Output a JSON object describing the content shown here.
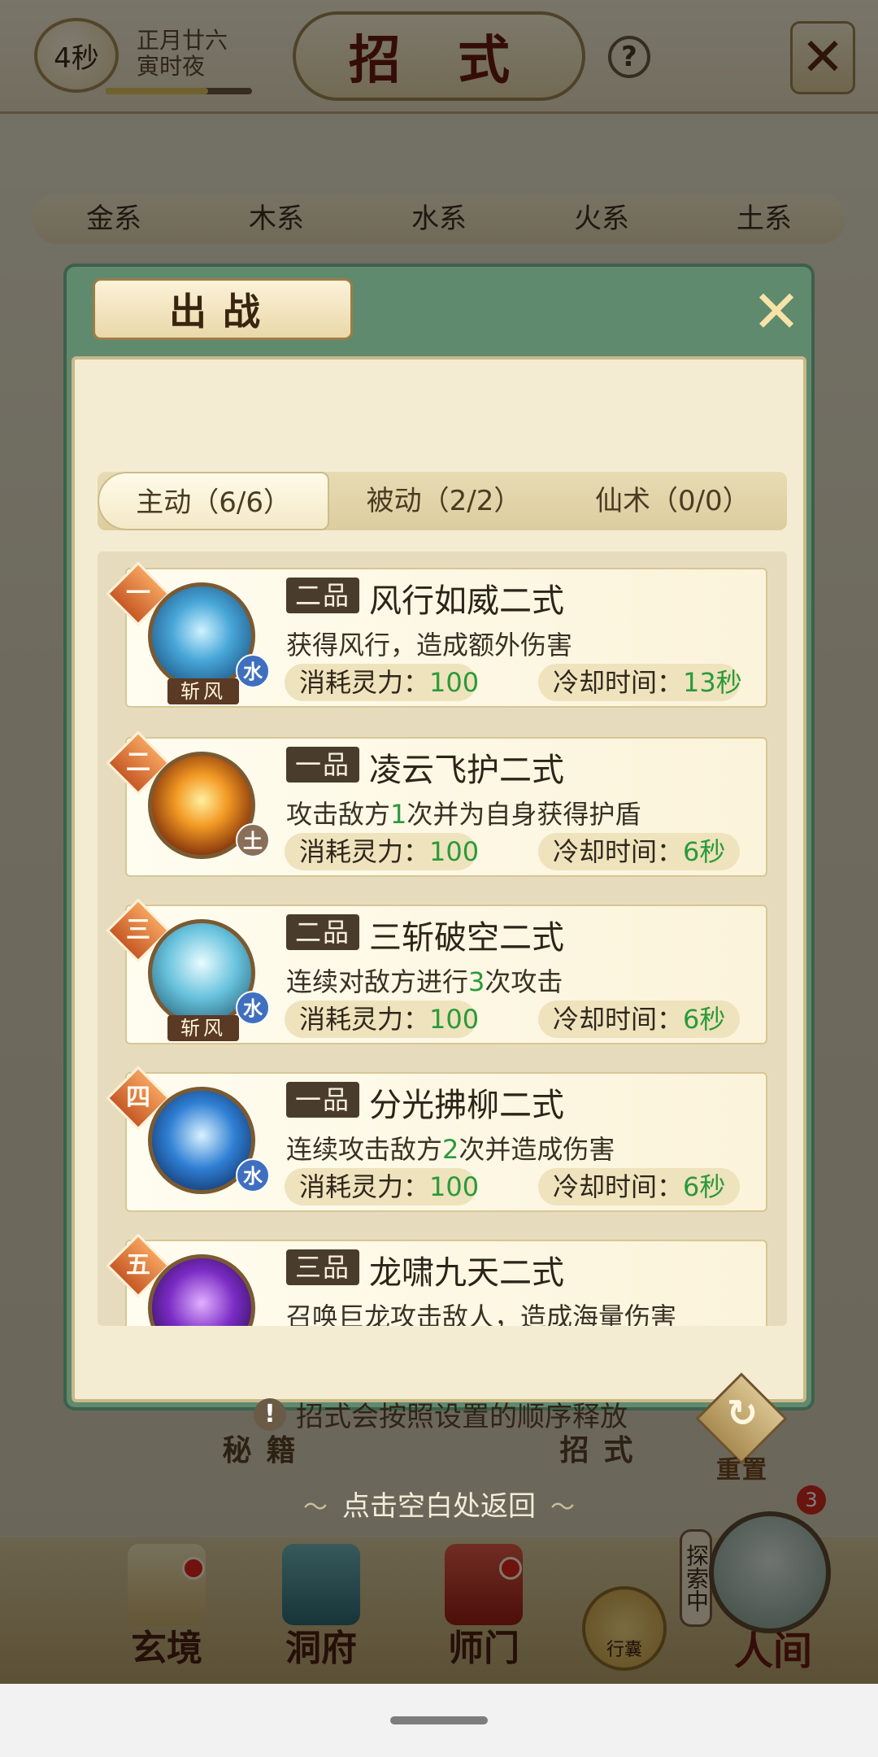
{
  "header": {
    "timer": "4秒",
    "date_line1": "正月廿六",
    "date_line2": "寅时夜",
    "time_progress": 0.7,
    "title": "招 式",
    "help_symbol": "?",
    "close_symbol": "✕"
  },
  "element_tabs": [
    "金系",
    "木系",
    "水系",
    "火系",
    "土系"
  ],
  "bg_bottom_tabs": [
    "秘籍",
    "招式"
  ],
  "modal": {
    "title": "出战",
    "close_symbol": "✕",
    "tabs": [
      {
        "label": "主动（6/6）",
        "active": true
      },
      {
        "label": "被动（2/2）",
        "active": false
      },
      {
        "label": "仙术（0/0）",
        "active": false
      }
    ],
    "skills": [
      {
        "order": "一",
        "grade": "二品",
        "name": "风行如威二式",
        "desc": [
          "获得风行，造成额外伤害"
        ],
        "type": "斩风",
        "element": "水",
        "mana_label": "消耗灵力：",
        "mana": "100",
        "cd_label": "冷却时间：",
        "cd": "13秒"
      },
      {
        "order": "二",
        "grade": "一品",
        "name": "凌云飞护二式",
        "desc": [
          "攻击敌方",
          "1",
          "次并为自身获得护盾"
        ],
        "type": "",
        "element": "土",
        "mana_label": "消耗灵力：",
        "mana": "100",
        "cd_label": "冷却时间：",
        "cd": "6秒"
      },
      {
        "order": "三",
        "grade": "二品",
        "name": "三斩破空二式",
        "desc": [
          "连续对敌方进行",
          "3",
          "次攻击"
        ],
        "type": "斩风",
        "element": "水",
        "mana_label": "消耗灵力：",
        "mana": "100",
        "cd_label": "冷却时间：",
        "cd": "6秒"
      },
      {
        "order": "四",
        "grade": "一品",
        "name": "分光拂柳二式",
        "desc": [
          "连续攻击敌方",
          "2",
          "次并造成伤害"
        ],
        "type": "",
        "element": "水",
        "mana_label": "消耗灵力：",
        "mana": "100",
        "cd_label": "冷却时间：",
        "cd": "6秒"
      },
      {
        "order": "五",
        "grade": "三品",
        "name": "龙啸九天二式",
        "desc": [
          "召唤巨龙攻击敌人，造成海量伤害"
        ],
        "type": "",
        "element": "",
        "mana_label": "",
        "mana": "",
        "cd_label": "",
        "cd": ""
      }
    ],
    "hint_icon": "!",
    "hint_text": "招式会按照设置的顺序释放",
    "reset_label": "重置",
    "reset_glyph": "↻"
  },
  "back_hint": "点击空白处返回",
  "bottom_nav": [
    {
      "label": "玄境",
      "dot": true
    },
    {
      "label": "洞府",
      "dot": false
    },
    {
      "label": "师门",
      "dot": true
    }
  ],
  "xingnang_label": "行囊",
  "explore_tag": "探索中",
  "world_label": "人间",
  "world_count": "3",
  "colors": {
    "highlight_green": "#2a9a3a",
    "modal_green": "#5f8a6e",
    "title_red": "#6a1a10"
  },
  "icons": [
    "help-icon",
    "close-icon",
    "reset-icon",
    "exclamation-icon"
  ]
}
